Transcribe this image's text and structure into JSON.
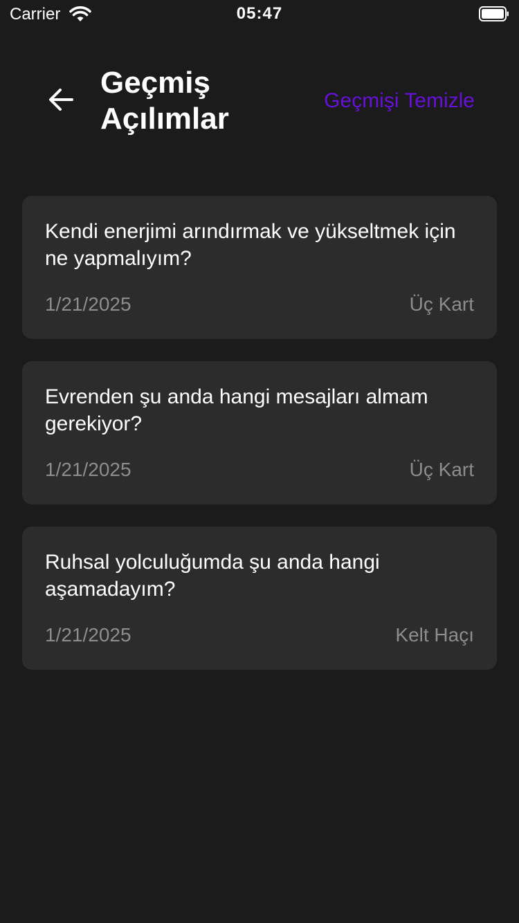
{
  "status_bar": {
    "carrier": "Carrier",
    "time": "05:47",
    "wifi_icon": "wifi-icon",
    "battery_icon": "battery-full-icon"
  },
  "header": {
    "back_icon": "arrow-left-icon",
    "title": "Geçmiş Açılımlar",
    "clear_label": "Geçmişi Temizle"
  },
  "colors": {
    "background": "#1b1b1b",
    "card_background": "#2c2c2d",
    "accent": "#6610d8",
    "secondary_text": "#8d8d8f",
    "primary_text": "#ffffff"
  },
  "readings": [
    {
      "question": "Kendi enerjimi arındırmak ve yükseltmek için ne yapmalıyım?",
      "date": "1/21/2025",
      "spread": "Üç Kart"
    },
    {
      "question": "Evrenden şu anda hangi mesajları almam gerekiyor?",
      "date": "1/21/2025",
      "spread": "Üç Kart"
    },
    {
      "question": "Ruhsal yolculuğumda şu anda hangi aşamadayım?",
      "date": "1/21/2025",
      "spread": "Kelt Haçı"
    }
  ]
}
